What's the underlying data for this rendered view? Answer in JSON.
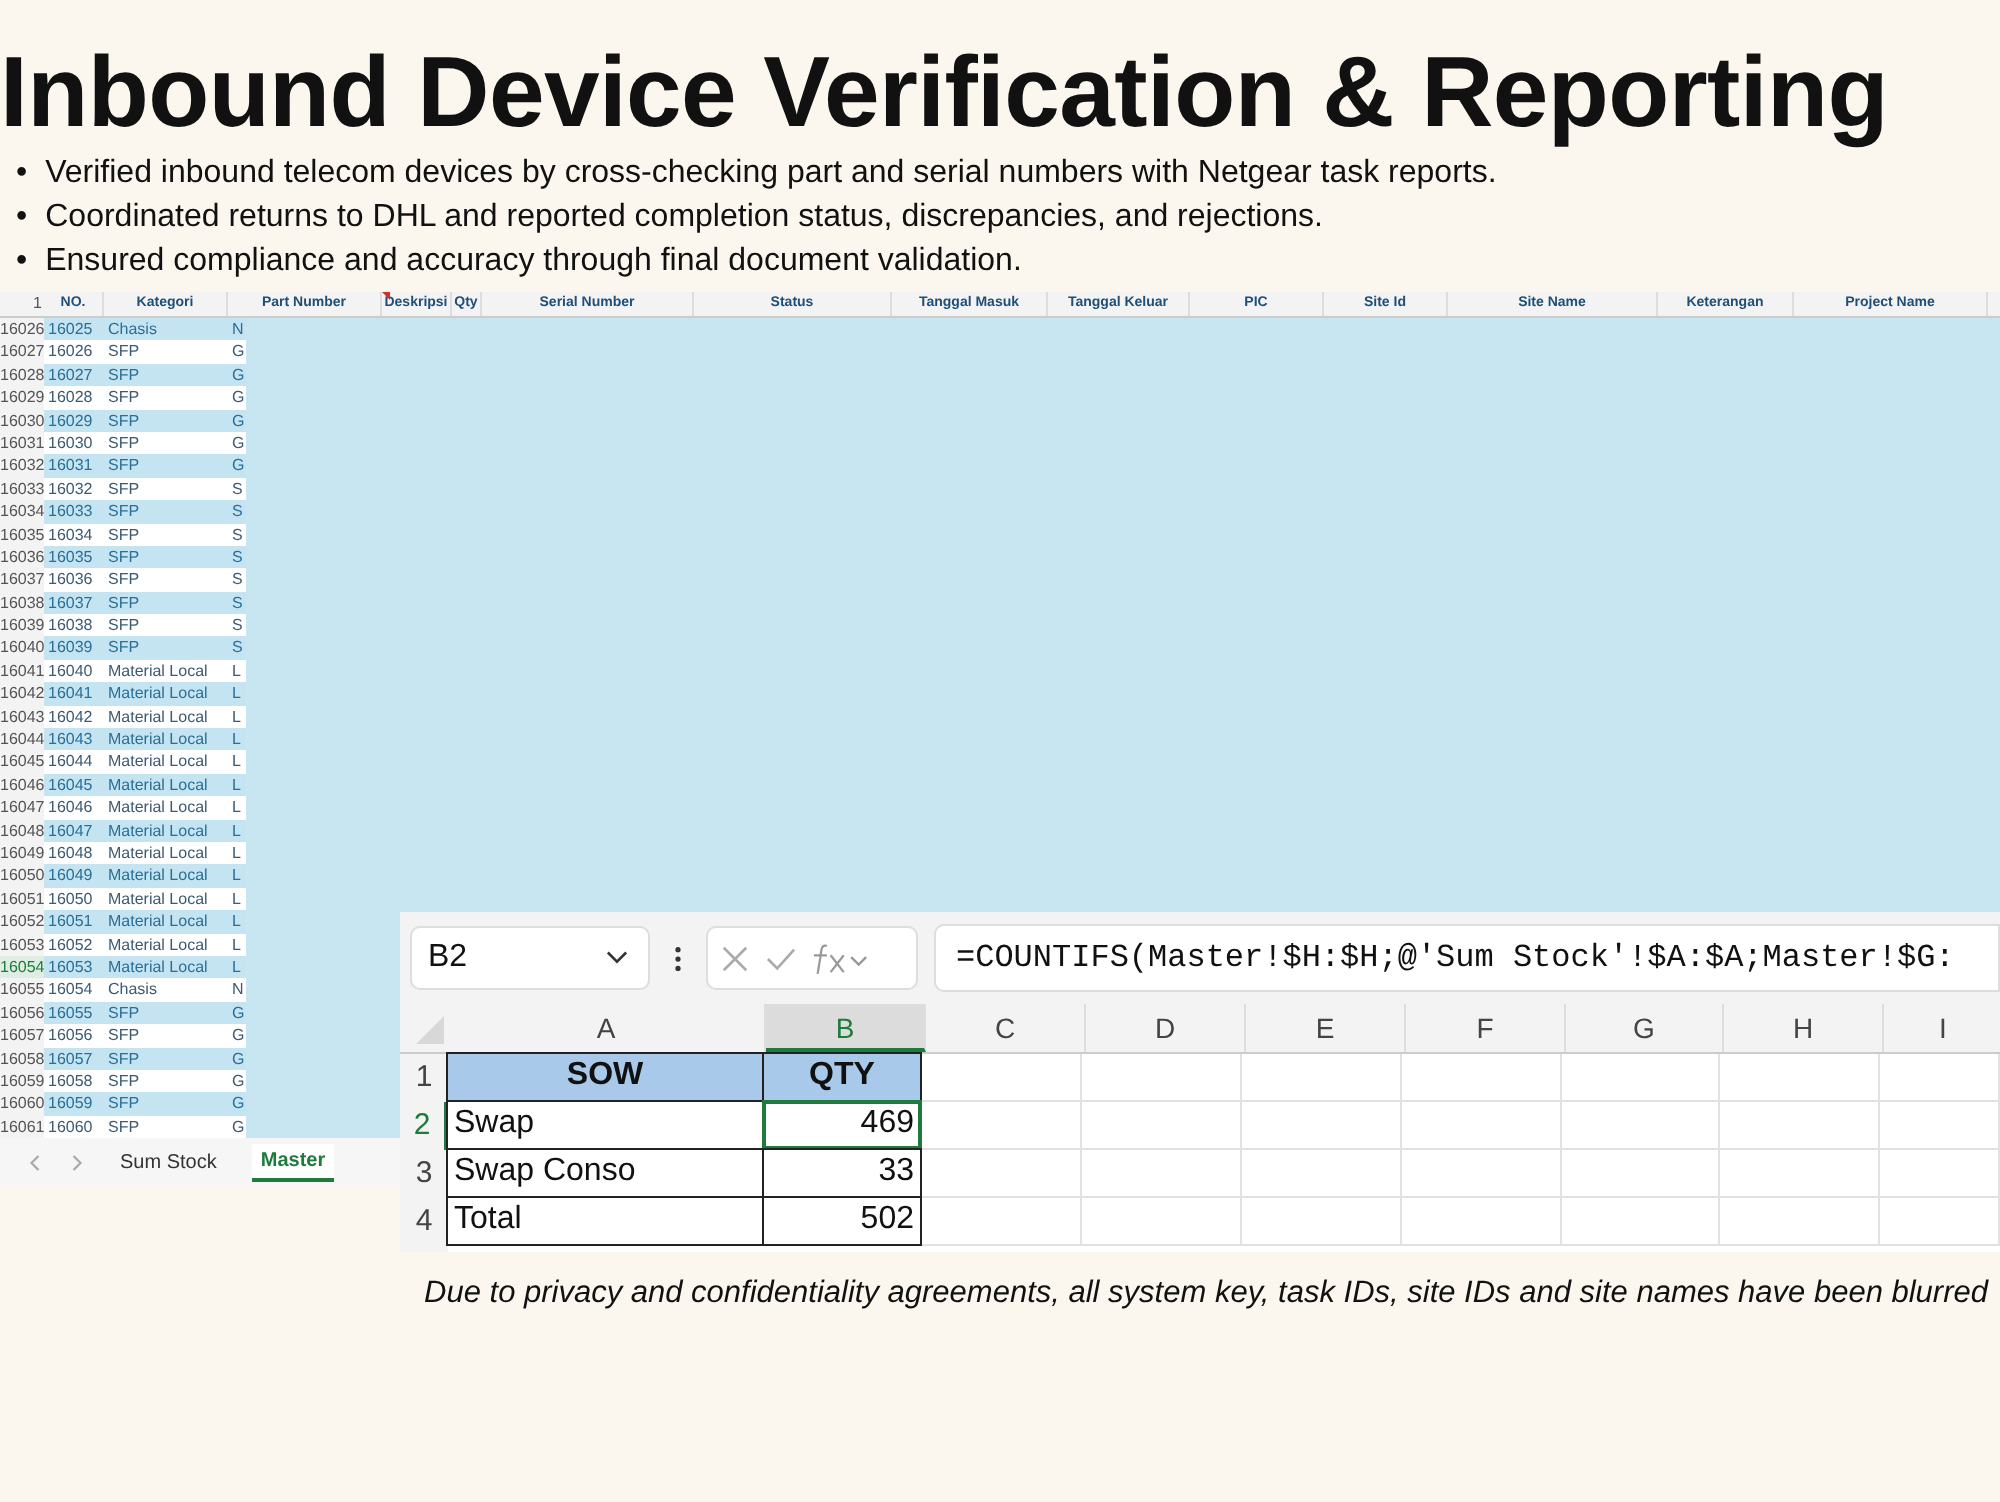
{
  "title": "Inbound Device Verification & Reporting",
  "bullet_marker": "•",
  "bullets": [
    "Verified inbound telecom devices by cross-checking part and serial numbers with Netgear task reports.",
    "Coordinated returns to DHL and reported completion status, discrepancies, and rejections.",
    "Ensured compliance and accuracy through final document validation."
  ],
  "master_sheet": {
    "header_row": "1",
    "columns": [
      "NO.",
      "Kategori",
      "Part Number",
      "Deskripsi",
      "Qty",
      "Serial Number",
      "Status",
      "Tanggal Masuk",
      "Tanggal Keluar",
      "PIC",
      "Site Id",
      "Site Name",
      "Keterangan",
      "Project Name"
    ],
    "rows": [
      {
        "row": "16026",
        "no": "16025",
        "kategori": "Chasis",
        "column_3": "N",
        "shaded": true,
        "selected": false
      },
      {
        "row": "16027",
        "no": "16026",
        "kategori": "SFP",
        "column_3": "G",
        "shaded": false,
        "selected": false
      },
      {
        "row": "16028",
        "no": "16027",
        "kategori": "SFP",
        "column_3": "G",
        "shaded": true,
        "selected": false
      },
      {
        "row": "16029",
        "no": "16028",
        "kategori": "SFP",
        "column_3": "G",
        "shaded": false,
        "selected": false
      },
      {
        "row": "16030",
        "no": "16029",
        "kategori": "SFP",
        "column_3": "G",
        "shaded": true,
        "selected": false
      },
      {
        "row": "16031",
        "no": "16030",
        "kategori": "SFP",
        "column_3": "G",
        "shaded": false,
        "selected": false
      },
      {
        "row": "16032",
        "no": "16031",
        "kategori": "SFP",
        "column_3": "G",
        "shaded": true,
        "selected": false
      },
      {
        "row": "16033",
        "no": "16032",
        "kategori": "SFP",
        "column_3": "S",
        "shaded": false,
        "selected": false
      },
      {
        "row": "16034",
        "no": "16033",
        "kategori": "SFP",
        "column_3": "S",
        "shaded": true,
        "selected": false
      },
      {
        "row": "16035",
        "no": "16034",
        "kategori": "SFP",
        "column_3": "S",
        "shaded": false,
        "selected": false
      },
      {
        "row": "16036",
        "no": "16035",
        "kategori": "SFP",
        "column_3": "S",
        "shaded": true,
        "selected": false
      },
      {
        "row": "16037",
        "no": "16036",
        "kategori": "SFP",
        "column_3": "S",
        "shaded": false,
        "selected": false
      },
      {
        "row": "16038",
        "no": "16037",
        "kategori": "SFP",
        "column_3": "S",
        "shaded": true,
        "selected": false
      },
      {
        "row": "16039",
        "no": "16038",
        "kategori": "SFP",
        "column_3": "S",
        "shaded": false,
        "selected": false
      },
      {
        "row": "16040",
        "no": "16039",
        "kategori": "SFP",
        "column_3": "S",
        "shaded": true,
        "selected": false
      },
      {
        "row": "16041",
        "no": "16040",
        "kategori": "Material Local",
        "column_3": "L",
        "shaded": false,
        "selected": false
      },
      {
        "row": "16042",
        "no": "16041",
        "kategori": "Material Local",
        "column_3": "L",
        "shaded": true,
        "selected": false
      },
      {
        "row": "16043",
        "no": "16042",
        "kategori": "Material Local",
        "column_3": "L",
        "shaded": false,
        "selected": false
      },
      {
        "row": "16044",
        "no": "16043",
        "kategori": "Material Local",
        "column_3": "L",
        "shaded": true,
        "selected": false
      },
      {
        "row": "16045",
        "no": "16044",
        "kategori": "Material Local",
        "column_3": "L",
        "shaded": false,
        "selected": false
      },
      {
        "row": "16046",
        "no": "16045",
        "kategori": "Material Local",
        "column_3": "L",
        "shaded": true,
        "selected": false
      },
      {
        "row": "16047",
        "no": "16046",
        "kategori": "Material Local",
        "column_3": "L",
        "shaded": false,
        "selected": false
      },
      {
        "row": "16048",
        "no": "16047",
        "kategori": "Material Local",
        "column_3": "L",
        "shaded": true,
        "selected": false
      },
      {
        "row": "16049",
        "no": "16048",
        "kategori": "Material Local",
        "column_3": "L",
        "shaded": false,
        "selected": false
      },
      {
        "row": "16050",
        "no": "16049",
        "kategori": "Material Local",
        "column_3": "L",
        "shaded": true,
        "selected": false
      },
      {
        "row": "16051",
        "no": "16050",
        "kategori": "Material Local",
        "column_3": "L",
        "shaded": false,
        "selected": false
      },
      {
        "row": "16052",
        "no": "16051",
        "kategori": "Material Local",
        "column_3": "L",
        "shaded": true,
        "selected": false
      },
      {
        "row": "16053",
        "no": "16052",
        "kategori": "Material Local",
        "column_3": "L",
        "shaded": false,
        "selected": false
      },
      {
        "row": "16054",
        "no": "16053",
        "kategori": "Material Local",
        "column_3": "L",
        "shaded": true,
        "selected": true
      },
      {
        "row": "16055",
        "no": "16054",
        "kategori": "Chasis",
        "column_3": "N",
        "shaded": false,
        "selected": false
      },
      {
        "row": "16056",
        "no": "16055",
        "kategori": "SFP",
        "column_3": "G",
        "shaded": true,
        "selected": false
      },
      {
        "row": "16057",
        "no": "16056",
        "kategori": "SFP",
        "column_3": "G",
        "shaded": false,
        "selected": false
      },
      {
        "row": "16058",
        "no": "16057",
        "kategori": "SFP",
        "column_3": "G",
        "shaded": true,
        "selected": false
      },
      {
        "row": "16059",
        "no": "16058",
        "kategori": "SFP",
        "column_3": "G",
        "shaded": false,
        "selected": false
      },
      {
        "row": "16060",
        "no": "16059",
        "kategori": "SFP",
        "column_3": "G",
        "shaded": true,
        "selected": false
      },
      {
        "row": "16061",
        "no": "16060",
        "kategori": "SFP",
        "column_3": "G",
        "shaded": false,
        "selected": false
      }
    ],
    "tabs": [
      {
        "label": "Sum Stock",
        "selected": false
      },
      {
        "label": "Master",
        "selected": true
      }
    ]
  },
  "sum_sheet": {
    "name_box": "B2",
    "formula": "=COUNTIFS(Master!$H:$H;@'Sum Stock'!$A:$A;Master!$G:",
    "columns": [
      {
        "label": "A",
        "selected": false
      },
      {
        "label": "B",
        "selected": true
      },
      {
        "label": "C",
        "selected": false
      },
      {
        "label": "D",
        "selected": false
      },
      {
        "label": "E",
        "selected": false
      },
      {
        "label": "F",
        "selected": false
      },
      {
        "label": "G",
        "selected": false
      },
      {
        "label": "H",
        "selected": false
      },
      {
        "label": "I",
        "selected": false
      }
    ],
    "rows": [
      {
        "row": "1",
        "kind": "header",
        "cells": [
          "SOW",
          "QTY"
        ],
        "selected": false
      },
      {
        "row": "2",
        "kind": "data",
        "cells": [
          "Swap",
          "469"
        ],
        "selected": true
      },
      {
        "row": "3",
        "kind": "data",
        "cells": [
          "Swap Conso",
          "33"
        ],
        "selected": false
      },
      {
        "row": "4",
        "kind": "data",
        "cells": [
          "Total",
          "502"
        ],
        "selected": false
      }
    ]
  },
  "note": "Due to privacy and confidentiality agreements, all system key, task IDs, site IDs and site names have been blurred"
}
